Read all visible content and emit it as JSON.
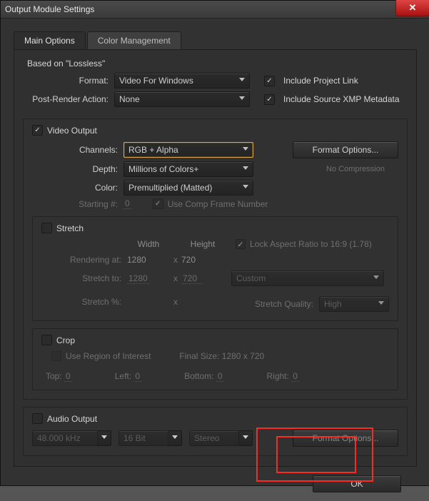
{
  "window": {
    "title": "Output Module Settings"
  },
  "tabs": {
    "main": "Main Options",
    "color": "Color Management"
  },
  "based_on": {
    "label": "Based on",
    "value": "\"Lossless\""
  },
  "format": {
    "label": "Format:",
    "value": "Video For Windows",
    "include_project_link": "Include Project Link",
    "include_project_link_checked": true,
    "action_label": "Post-Render Action:",
    "action_value": "None",
    "include_xmp": "Include Source XMP Metadata",
    "include_xmp_checked": true
  },
  "video": {
    "legend": "Video Output",
    "checked": true,
    "channels_label": "Channels:",
    "channels_value": "RGB + Alpha",
    "depth_label": "Depth:",
    "depth_value": "Millions of Colors+",
    "color_label": "Color:",
    "color_value": "Premultiplied (Matted)",
    "starting_label": "Starting #:",
    "starting_value": "0",
    "use_comp_frame": "Use Comp Frame Number",
    "use_comp_frame_checked": true,
    "format_options": "Format Options...",
    "compression": "No Compression"
  },
  "stretch": {
    "legend": "Stretch",
    "checked": false,
    "width": "Width",
    "height": "Height",
    "lock_label": "Lock Aspect Ratio to 16:9 (1.78)",
    "lock_checked": true,
    "rendering_label": "Rendering at:",
    "rendering_w": "1280",
    "rendering_h": "720",
    "stretch_to_label": "Stretch to:",
    "stretch_w": "1280",
    "stretch_h": "720",
    "preset": "Custom",
    "stretch_pct_label": "Stretch %:",
    "quality_label": "Stretch Quality:",
    "quality_value": "High"
  },
  "crop": {
    "legend": "Crop",
    "checked": false,
    "roi": "Use Region of Interest",
    "final_size": "Final Size: 1280 x 720",
    "top": "Top:",
    "top_v": "0",
    "left": "Left:",
    "left_v": "0",
    "bottom": "Bottom:",
    "bottom_v": "0",
    "right": "Right:",
    "right_v": "0"
  },
  "audio": {
    "legend": "Audio Output",
    "checked": false,
    "rate": "48.000 kHz",
    "bits": "16 Bit",
    "channels": "Stereo",
    "format_options": "Format Options..."
  },
  "buttons": {
    "ok": "OK"
  }
}
